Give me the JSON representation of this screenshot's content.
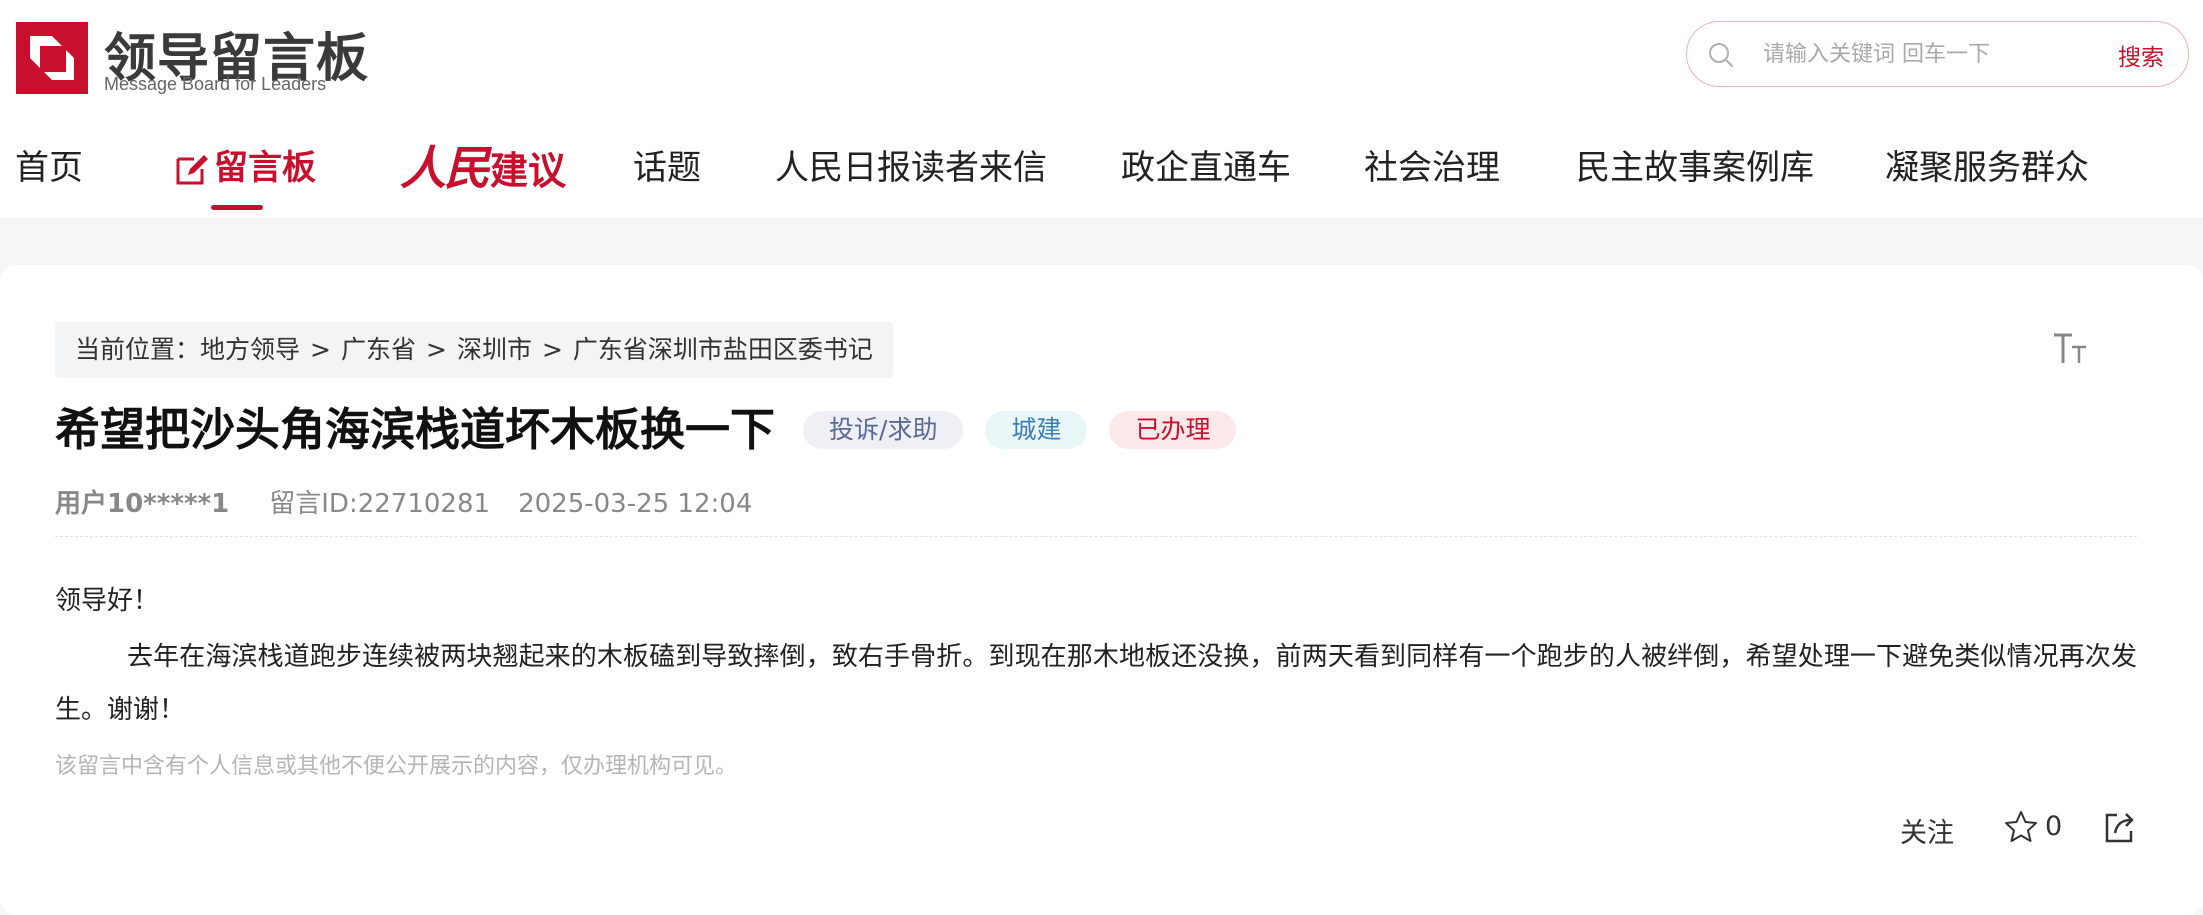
{
  "brand": {
    "title": "领导留言板",
    "subtitle": "Message Board for Leaders",
    "accent": "#c8102e"
  },
  "search": {
    "placeholder": "请输入关键词 回车一下",
    "button_label": "搜索",
    "icon": "search-icon"
  },
  "nav": {
    "items": [
      {
        "label": "首页"
      },
      {
        "label": "留言板",
        "icon": "edit-icon",
        "active": true
      },
      {
        "label_prefix": "人民",
        "label": "建议"
      },
      {
        "label": "话题"
      },
      {
        "label": "人民日报读者来信"
      },
      {
        "label": "政企直通车"
      },
      {
        "label": "社会治理"
      },
      {
        "label": "民主故事案例库"
      },
      {
        "label": "凝聚服务群众"
      }
    ]
  },
  "breadcrumb": {
    "prefix": "当前位置：",
    "items": [
      "地方领导",
      "广东省",
      "深圳市",
      "广东省深圳市盐田区委书记"
    ],
    "separator": ">"
  },
  "message": {
    "title": "希望把沙头角海滨栈道坏木板换一下",
    "tags": {
      "type": "投诉/求助",
      "category": "城建",
      "status": "已办理"
    },
    "user": "用户10*****1",
    "id_text": "留言ID:22710281",
    "datetime": "2025-03-25 12:04",
    "greeting": "领导好！",
    "body": "去年在海滨栈道跑步连续被两块翘起来的木板磕到导致摔倒，致右手骨折。到现在那木地板还没换，前两天看到同样有一个跑步的人被绊倒，希望处理一下避免类似情况再次发生。谢谢！",
    "notice": "该留言中含有个人信息或其他不便公开展示的内容，仅办理机构可见。"
  },
  "actions": {
    "follow_label": "关注",
    "like_count": "0",
    "star_icon": "star-icon",
    "share_icon": "share-icon"
  }
}
